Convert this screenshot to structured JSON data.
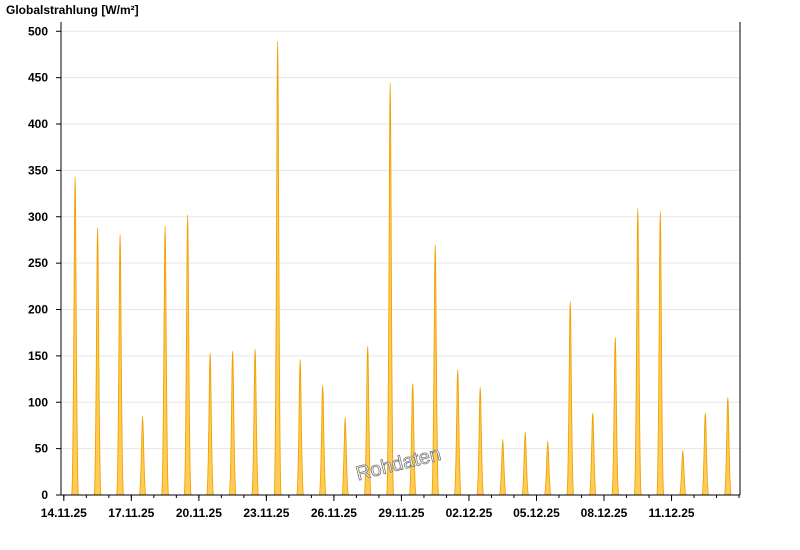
{
  "chart_data": {
    "type": "area",
    "ylabel": "Globalstrahlung [W/m²]",
    "xlabel": "",
    "ylim": [
      0,
      510
    ],
    "xlim": [
      "2025-11-13T21:00",
      "2025-12-14T01:00"
    ],
    "y_ticks": [
      0,
      50,
      100,
      150,
      200,
      250,
      300,
      350,
      400,
      450,
      500
    ],
    "x_ticks": [
      "14.11.25",
      "17.11.25",
      "20.11.25",
      "23.11.25",
      "26.11.25",
      "29.11.25",
      "02.12.25",
      "05.12.25",
      "08.12.25",
      "11.12.25"
    ],
    "x_tick_dates": [
      "2025-11-14",
      "2025-11-17",
      "2025-11-20",
      "2025-11-23",
      "2025-11-26",
      "2025-11-29",
      "2025-12-02",
      "2025-12-05",
      "2025-12-08",
      "2025-12-11"
    ],
    "grid": "horizontal",
    "fill_color": "#ffcc55",
    "line_color": "#f0a000",
    "series": [
      {
        "x": [
          "2025-11-14",
          "2025-11-15",
          "2025-11-16",
          "2025-11-17",
          "2025-11-18",
          "2025-11-19",
          "2025-11-20",
          "2025-11-21",
          "2025-11-22",
          "2025-11-23",
          "2025-11-24",
          "2025-11-25",
          "2025-11-26",
          "2025-11-27",
          "2025-11-28",
          "2025-11-29",
          "2025-11-30",
          "2025-12-01",
          "2025-12-02",
          "2025-12-03",
          "2025-12-04",
          "2025-12-05",
          "2025-12-06",
          "2025-12-07",
          "2025-12-08",
          "2025-12-09",
          "2025-12-10",
          "2025-12-11",
          "2025-12-12",
          "2025-12-13"
        ],
        "values": [
          343,
          288,
          281,
          85,
          290,
          302,
          153,
          155,
          157,
          489,
          146,
          118,
          84,
          160,
          444,
          120,
          270,
          135,
          116,
          60,
          68,
          58,
          209,
          88,
          170,
          309,
          306,
          48,
          88,
          105
        ]
      }
    ]
  },
  "watermark": "Rohdaten"
}
